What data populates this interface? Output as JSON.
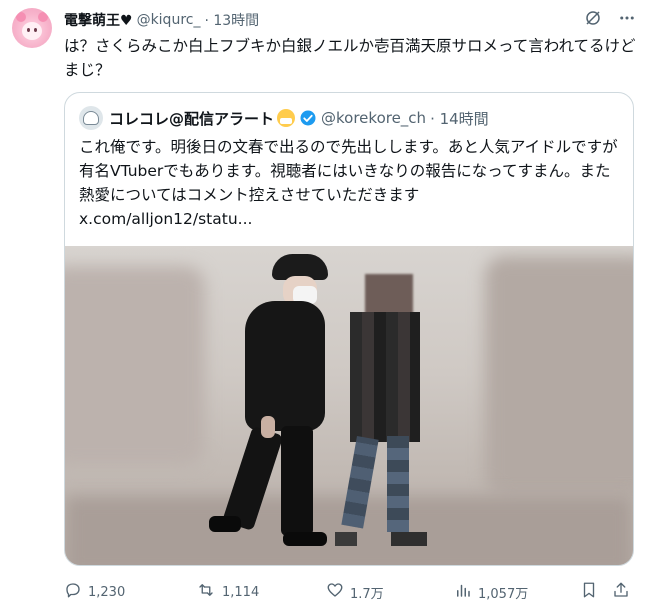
{
  "author": {
    "name": "電撃萌王♥",
    "handle": "@kiqurc_",
    "time": "· 13時間"
  },
  "tweet": {
    "text": "は？さくらみこか白上フブキか白銀ノエルか壱百満天原サロメって言われてるけどまじ？"
  },
  "quote": {
    "name": "コレコレ@配信アラート",
    "handle": "@korekore_ch",
    "time": "· 14時間",
    "text": "これ俺です。明後日の文春で出るので先出しします。あと人気アイドルですが有名VTuberでもあります。視聴者にはいきなりの報告になってすまん。また熱愛についてはコメント控えさせていただきます",
    "link": "x.com/alljon12/statu..."
  },
  "actions": {
    "replies": "1,230",
    "reposts": "1,114",
    "likes": "1.7万",
    "views": "1,057万"
  },
  "colors": {
    "text": "#0f1419",
    "secondary": "#536471",
    "border": "#cfd9de",
    "verified": "#1d9bf0"
  },
  "icons": [
    "grok-icon",
    "more-icon",
    "verified-icon",
    "reply-icon",
    "repost-icon",
    "like-icon",
    "views-icon",
    "bookmark-icon",
    "share-icon"
  ]
}
